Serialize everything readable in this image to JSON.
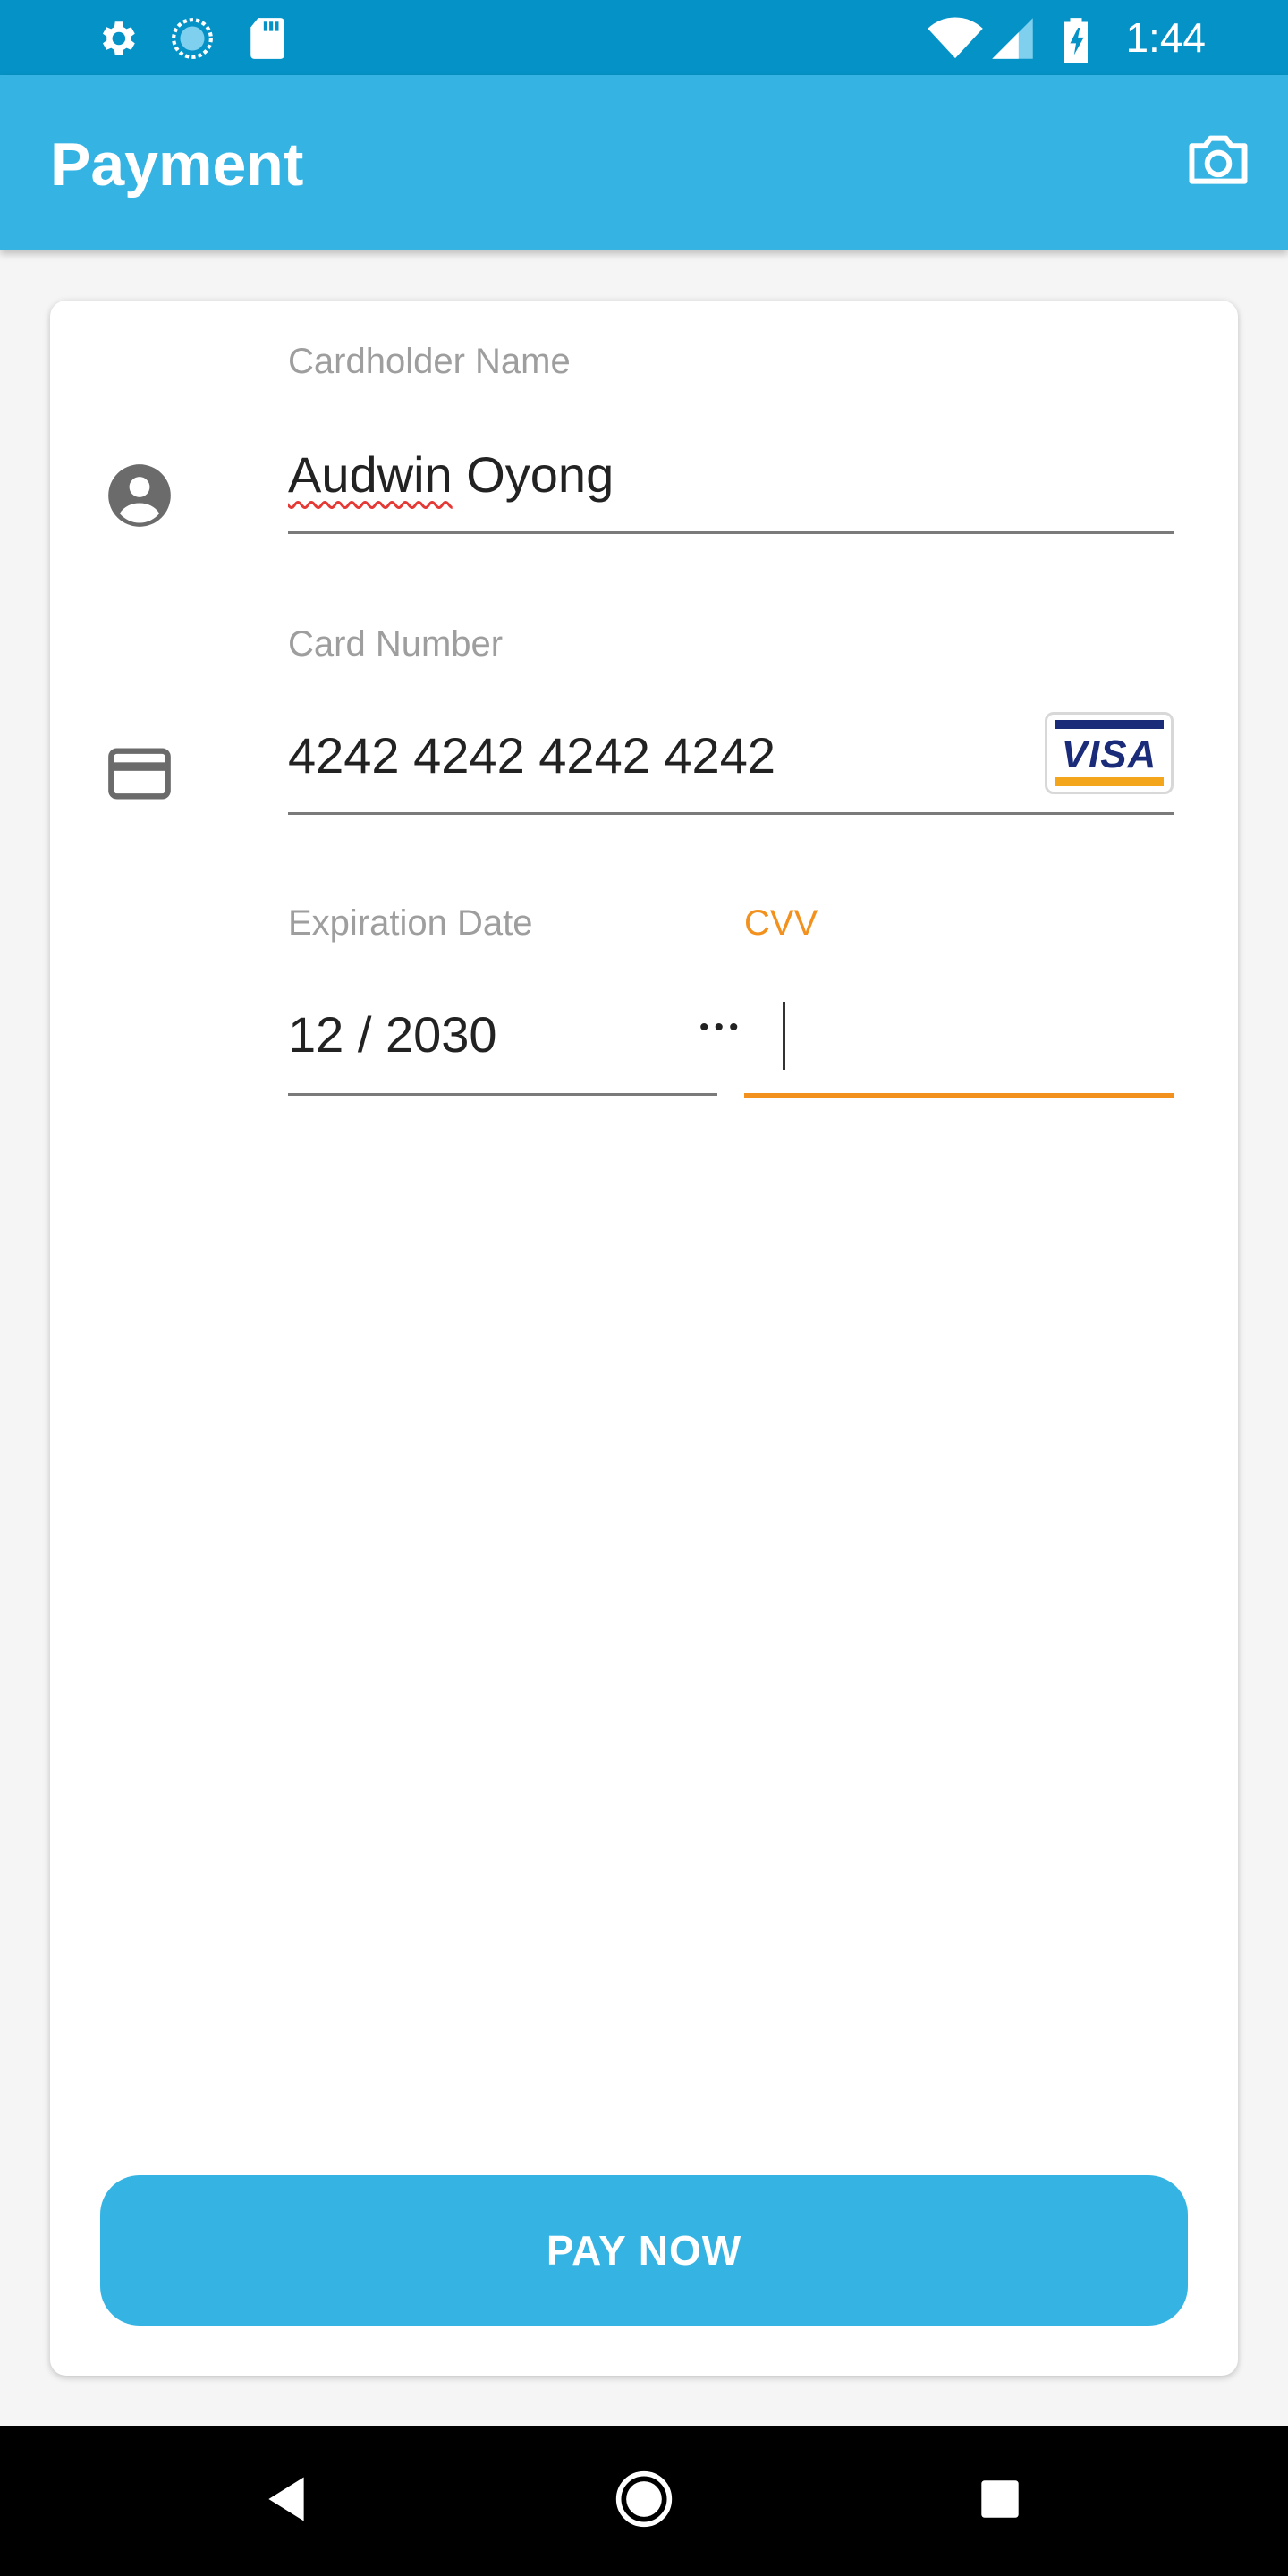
{
  "status_bar": {
    "time": "1:44",
    "icons": [
      "settings-icon",
      "sync-icon",
      "sd-card-icon",
      "wifi-icon",
      "signal-icon",
      "battery-charging-icon"
    ]
  },
  "app_bar": {
    "title": "Payment",
    "camera_icon": "camera-icon"
  },
  "form": {
    "cardholder": {
      "label": "Cardholder Name",
      "first_name": "Audwin",
      "last_name": " Oyong",
      "icon": "account-circle-icon"
    },
    "card_number": {
      "label": "Card Number",
      "value": "4242 4242 4242 4242",
      "icon": "credit-card-icon",
      "brand": "VISA"
    },
    "expiration": {
      "label": "Expiration Date",
      "value": "12 / 2030"
    },
    "cvv": {
      "label": "CVV",
      "masked_value": "•••"
    }
  },
  "pay_button": {
    "label": "PAY NOW"
  },
  "nav_bar": {
    "icons": [
      "back-icon",
      "home-icon",
      "recents-icon"
    ]
  },
  "colors": {
    "status_bar": "#0593c7",
    "app_bar": "#35b4e4",
    "accent": "#f2911d",
    "visa_blue": "#1a2b7a",
    "visa_gold": "#f3a51b",
    "spell_error": "#e53935"
  }
}
